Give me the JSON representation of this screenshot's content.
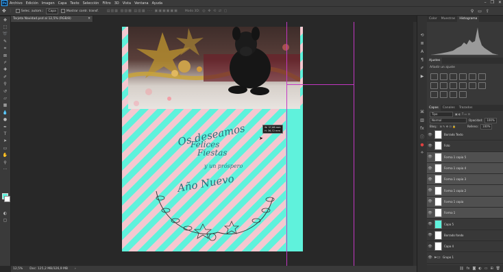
{
  "menu": {
    "logo": "Ps",
    "items": [
      "Archivo",
      "Edición",
      "Imagen",
      "Capa",
      "Texto",
      "Selección",
      "Filtro",
      "3D",
      "Vista",
      "Ventana",
      "Ayuda"
    ],
    "window_controls": [
      "–",
      "❐",
      "✕"
    ]
  },
  "options": {
    "auto_select_label": "Selec. autom.:",
    "layer_value": "Capa",
    "show_transform_label": "Mostrar contr. transf.",
    "mode3d_label": "Modo 3D:"
  },
  "document": {
    "tab_title": "Tarjeta Navidad.psd al 12,5% (RGB/8)",
    "close_icon": "✕",
    "tooltip_w": "W: 37,68 mm",
    "tooltip_h": "H: 36,72 mm",
    "handwriting": [
      "Os deseamos",
      "Felices",
      "Fiestas",
      "y un próspero",
      "Año Nuevo"
    ]
  },
  "status": {
    "zoom": "12,5%",
    "doc_size": "Doc: 125,2 MB/326,9 MB"
  },
  "panels": {
    "top_tabs": [
      "Color",
      "Muestras",
      "Histograma"
    ],
    "adjust_tab": "Ajustes",
    "add_adjust_label": "Añadir un ajuste",
    "layer_tabs": [
      "Capas",
      "Canales",
      "Trazados"
    ],
    "search_kind": "Tipo",
    "blend_mode": "Normal",
    "opacity_label": "Opacidad:",
    "opacity_value": "100%",
    "lock_label": "Bloq.:",
    "fill_label": "Relleno:",
    "fill_value": "100%"
  },
  "layers": [
    {
      "name": "Borrado Texto",
      "thumb": "white",
      "selected": false
    },
    {
      "name": "Foto",
      "thumb": "white",
      "selected": false
    },
    {
      "name": "Forma 1 copia 5",
      "thumb": "white",
      "selected": true
    },
    {
      "name": "Forma 1 copia 4",
      "thumb": "white",
      "selected": true
    },
    {
      "name": "Forma 1 copia 3",
      "thumb": "white",
      "selected": true
    },
    {
      "name": "Forma 1 copia 2",
      "thumb": "white",
      "selected": true
    },
    {
      "name": "Forma 1 copia",
      "thumb": "white",
      "selected": true
    },
    {
      "name": "Forma 1",
      "thumb": "white",
      "selected": true
    },
    {
      "name": "Capa 5",
      "thumb": "teal",
      "selected": false
    },
    {
      "name": "Borrado fondo",
      "thumb": "white",
      "selected": false
    },
    {
      "name": "Capa 4",
      "thumb": "white",
      "selected": false
    },
    {
      "name": "Grupo 1",
      "thumb": "folder",
      "selected": false
    }
  ],
  "colors": {
    "teal": "#5ff2dc",
    "pink": "#f4c8d0",
    "guide": "#c437c4",
    "ui_dark": "#282828",
    "ui_panel": "#383838"
  }
}
